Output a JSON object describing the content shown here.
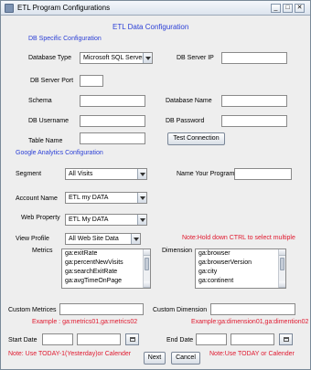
{
  "window": {
    "title": "ETL Program Configurations",
    "controls": [
      "_",
      "□",
      "✕"
    ]
  },
  "header": {
    "title": "ETL Data Configuration"
  },
  "db": {
    "section_title": "DB Specific Configuration",
    "database_type_label": "Database Type",
    "database_type_value": "Microsoft SQL Server",
    "server_ip_label": "DB Server IP",
    "server_port_label": "DB Server Port",
    "schema_label": "Schema",
    "database_name_label": "Database Name",
    "username_label": "DB Username",
    "password_label": "DB Password",
    "table_name_label": "Table Name",
    "test_connection_label": "Test Connection"
  },
  "ga": {
    "section_title": "Google Analytics Configuration",
    "segment_label": "Segment",
    "segment_value": "All Visits",
    "program_name_label": "Name Your Program",
    "account_label": "Account Name",
    "account_value": "ETL my DATA",
    "property_label": "Web Property",
    "property_value": "ETL My DATA",
    "view_label": "View Profile",
    "view_value": "All Web Site Data",
    "ctrl_note": "Note:Hold down CTRL to select multiple",
    "metrics_label": "Metrics",
    "metrics": [
      "ga:exitRate",
      "ga:percentNewVisits",
      "ga:searchExitRate",
      "ga:avgTimeOnPage"
    ],
    "dimension_label": "Dimension",
    "dimensions": [
      "ga:browser",
      "ga:browserVersion",
      "ga:city",
      "ga:continent"
    ],
    "custom_metrics_label": "Custom Metrices",
    "custom_dimension_label": "Custom Dimension",
    "metrics_example": "Example : ga:metrics01,ga:metrics02",
    "dimension_example": "Example:ga:dimension01,ga:dimention02",
    "start_date_label": "Start Date",
    "end_date_label": "End Date",
    "start_note": "Note: Use TODAY-1(Yesterday)or Calender",
    "end_note": "Note:Use TODAY or Calender"
  },
  "footer": {
    "next_label": "Next",
    "cancel_label": "Cancel"
  }
}
